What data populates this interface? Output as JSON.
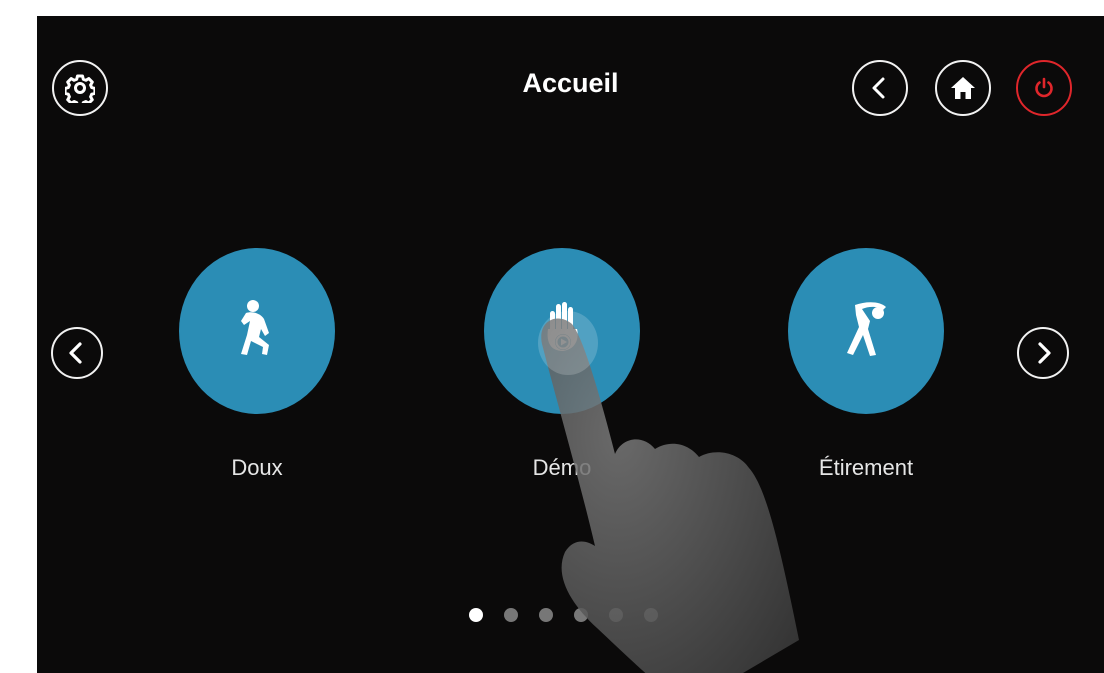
{
  "header": {
    "title": "Accueil",
    "icons": {
      "settings": "gear-icon",
      "back": "chevron-left-icon",
      "home": "home-icon",
      "power": "power-icon"
    },
    "power_color": "#e0262b"
  },
  "carousel": {
    "items": [
      {
        "label": "Doux",
        "icon": "walking-person-icon"
      },
      {
        "label": "Démo",
        "icon": "hand-play-icon"
      },
      {
        "label": "Étirement",
        "icon": "stretching-person-icon"
      }
    ],
    "accent_color": "#2b8db5",
    "page_count": 6,
    "current_page": 1
  }
}
